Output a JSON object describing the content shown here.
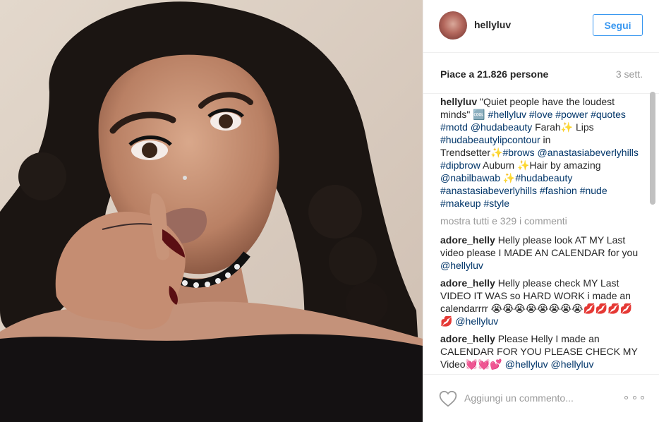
{
  "post": {
    "username": "hellyluv",
    "follow_label": "Segui",
    "likes_text": "Piace a 21.826 persone",
    "time_text": "3 sett."
  },
  "caption": {
    "user": "hellyluv",
    "parts": [
      {
        "t": "text",
        "v": "\"Quiet people have the loudest minds\" 🆒 "
      },
      {
        "t": "tag",
        "v": "#hellyluv"
      },
      {
        "t": "text",
        "v": " "
      },
      {
        "t": "tag",
        "v": "#love"
      },
      {
        "t": "text",
        "v": " "
      },
      {
        "t": "tag",
        "v": "#power"
      },
      {
        "t": "text",
        "v": " "
      },
      {
        "t": "tag",
        "v": "#quotes"
      },
      {
        "t": "text",
        "v": " "
      },
      {
        "t": "tag",
        "v": "#motd"
      },
      {
        "t": "text",
        "v": " "
      },
      {
        "t": "tag",
        "v": "@hudabeauty"
      },
      {
        "t": "text",
        "v": " Farah✨ Lips "
      },
      {
        "t": "tag",
        "v": "#hudabeautylipcontour"
      },
      {
        "t": "text",
        "v": " in Trendsetter✨"
      },
      {
        "t": "tag",
        "v": "#brows"
      },
      {
        "t": "text",
        "v": " "
      },
      {
        "t": "tag",
        "v": "@anastasiabeverlyhills"
      },
      {
        "t": "text",
        "v": " "
      },
      {
        "t": "tag",
        "v": "#dipbrow"
      },
      {
        "t": "text",
        "v": " Auburn ✨Hair by amazing "
      },
      {
        "t": "tag",
        "v": "@nabilbawab"
      },
      {
        "t": "text",
        "v": " ✨"
      },
      {
        "t": "tag",
        "v": "#hudabeauty"
      },
      {
        "t": "text",
        "v": " "
      },
      {
        "t": "tag",
        "v": "#anastasiabeverlyhills"
      },
      {
        "t": "text",
        "v": " "
      },
      {
        "t": "tag",
        "v": "#fashion"
      },
      {
        "t": "text",
        "v": " "
      },
      {
        "t": "tag",
        "v": "#nude"
      },
      {
        "t": "text",
        "v": " "
      },
      {
        "t": "tag",
        "v": "#makeup"
      },
      {
        "t": "text",
        "v": " "
      },
      {
        "t": "tag",
        "v": "#style"
      }
    ]
  },
  "view_all_label": "mostra tutti e 329 i commenti",
  "comments": [
    {
      "user": "adore_helly",
      "parts": [
        {
          "t": "text",
          "v": "Helly please look AT MY Last video please I MADE AN CALENDAR for you "
        },
        {
          "t": "tag",
          "v": "@hellyluv"
        }
      ]
    },
    {
      "user": "adore_helly",
      "parts": [
        {
          "t": "text",
          "v": "Helly please check MY Last VIDEO IT WAS so HARD WORK i made an calendarrrr 😭😭😭😭😭😭😭😭💋💋💋💋💋 "
        },
        {
          "t": "tag",
          "v": "@hellyluv"
        }
      ]
    },
    {
      "user": "adore_helly",
      "parts": [
        {
          "t": "text",
          "v": "Please Helly I made an CALENDAR FOR YOU PLEASE CHECK MY Video💓💓💕 "
        },
        {
          "t": "tag",
          "v": "@hellyluv"
        },
        {
          "t": "text",
          "v": " "
        },
        {
          "t": "tag",
          "v": "@hellyluv"
        }
      ]
    }
  ],
  "footer": {
    "comment_placeholder": "Aggiungi un commento...",
    "heart_icon": "heart-outline-icon",
    "more_icon": "more-options-icon"
  },
  "colors": {
    "link": "#003569",
    "accent": "#3897f0",
    "muted": "#999999"
  }
}
